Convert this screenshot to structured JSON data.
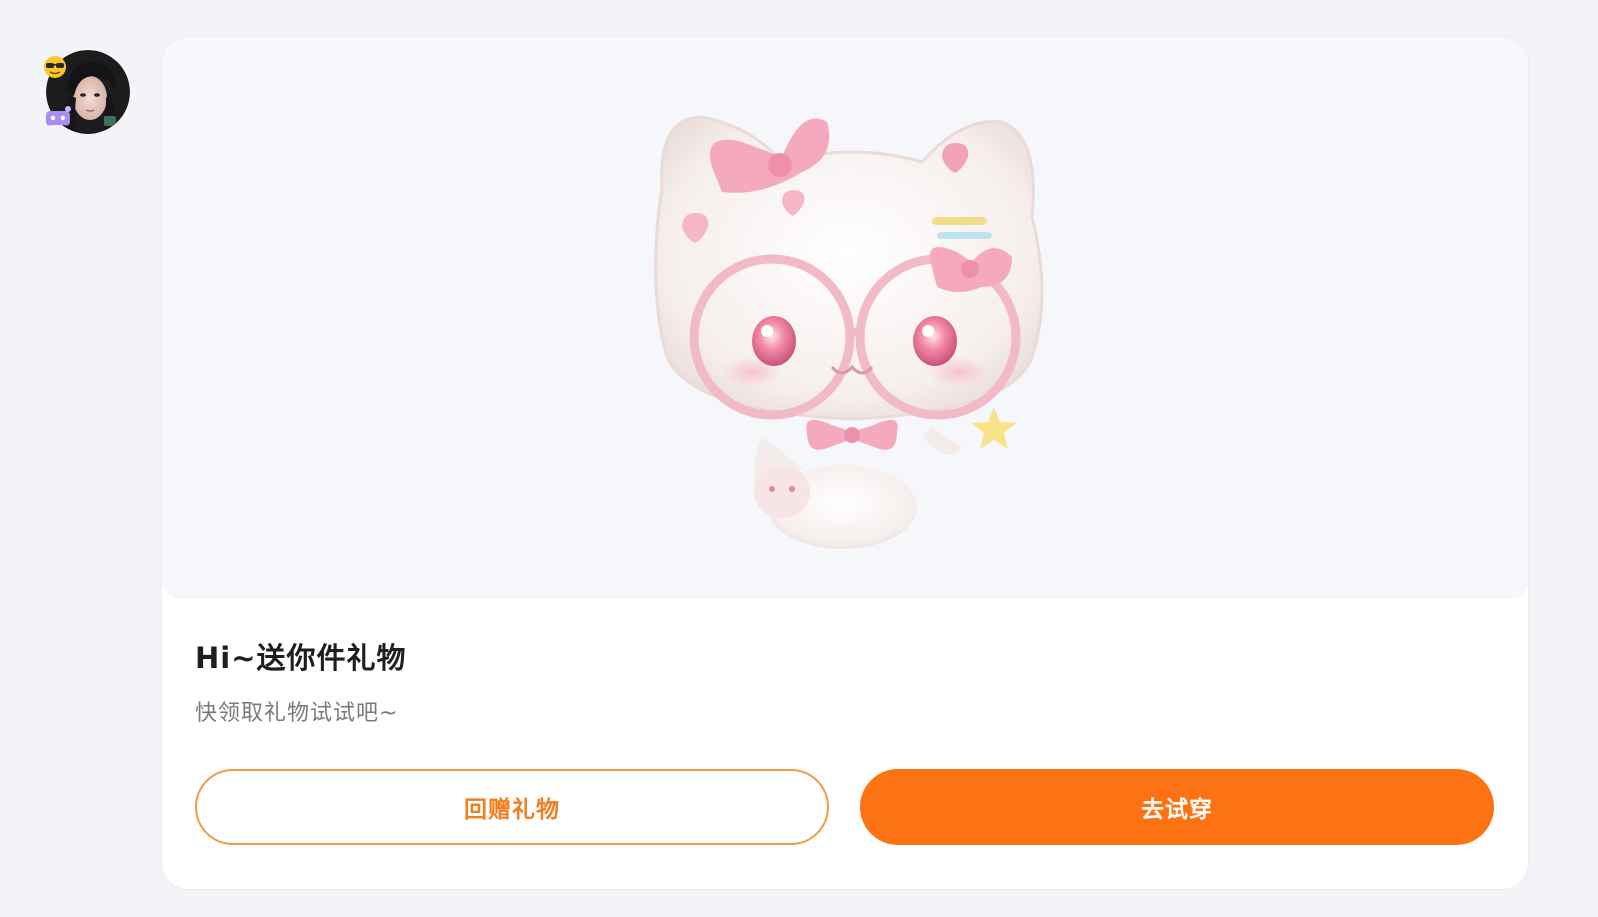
{
  "sender": {
    "avatar_icon": "user-avatar",
    "badge_icons": [
      "sunglasses-emoji-icon",
      "gamepad-toy-icon"
    ]
  },
  "gift_card": {
    "image_icon": "pink-white-cat-plush-with-glasses-and-bows",
    "title": "Hi~送你件礼物",
    "subtitle": "快领取礼物试试吧~",
    "buttons": {
      "return_gift_label": "回赠礼物",
      "try_on_label": "去试穿"
    }
  },
  "colors": {
    "accent_orange": "#fd7212",
    "outline_orange": "#f39a4a",
    "outline_text": "#f07f22",
    "page_background": "#f3f4f8",
    "card_background": "#ffffff"
  }
}
